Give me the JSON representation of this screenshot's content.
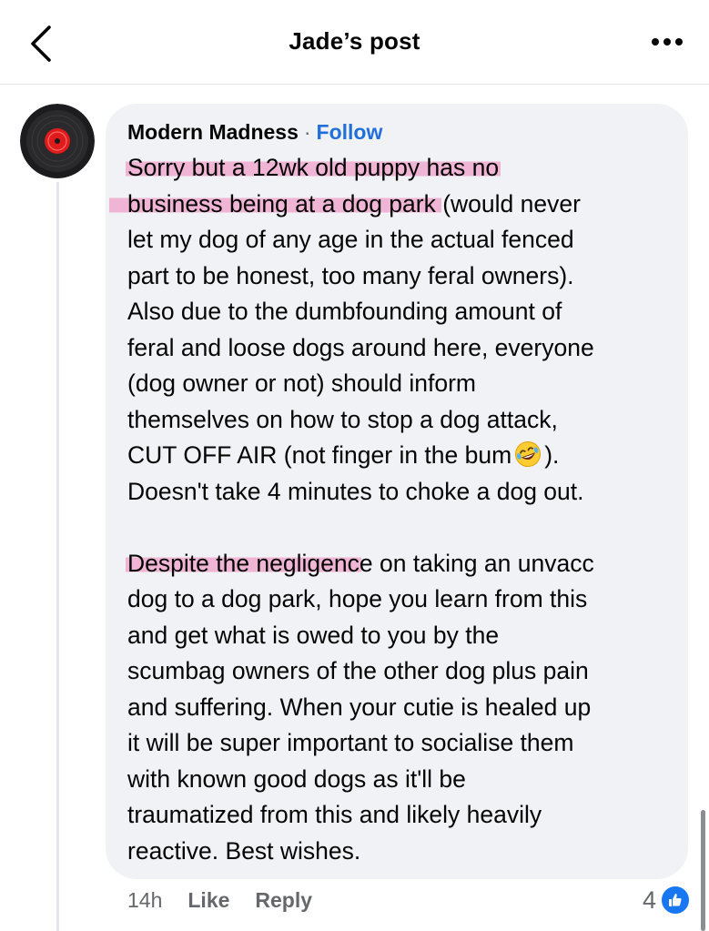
{
  "header": {
    "title": "Jade’s post",
    "back_icon": "chevron-left-icon",
    "more_icon": "more-horizontal-icon"
  },
  "comment": {
    "author": "Modern Madness",
    "separator": "·",
    "follow_label": "Follow",
    "lines_p1": {
      "l1": "Sorry but a 12wk old puppy has no",
      "l2a": "business being at a dog park",
      "l2b": " (would never",
      "l3": "let my dog of any age in the actual fenced",
      "l4": "part to be honest, too many feral owners).",
      "l5": "Also due to the dumbfounding amount of",
      "l6": "feral and loose dogs around here, everyone",
      "l7": "(dog owner or not) should inform",
      "l8": "themselves on how to stop a dog attack,",
      "l9a": "CUT OFF AIR (not finger in the bum",
      "l9b": ").",
      "l10": "Doesn't take 4 minutes to choke a dog out."
    },
    "lines_p2": {
      "l1a": "Despite the negligenc",
      "l1b": "e on taking an unvacc",
      "l2": "dog to a dog park, hope you learn from this",
      "l3": "and get what is owed to you by the",
      "l4": "scumbag owners of the other dog plus pain",
      "l5": "and suffering. When your cutie is healed up",
      "l6": "it will be super important to socialise them",
      "l7": "with known good dogs as it'll be",
      "l8": "traumatized from this and likely heavily",
      "l9": "reactive. Best wishes."
    },
    "emoji_name": "rolling-on-the-floor-laughing-emoji",
    "highlight_color": "#f082b9"
  },
  "actions": {
    "time": "14h",
    "like_label": "Like",
    "reply_label": "Reply",
    "reaction_count": "4",
    "reaction_icon": "like-thumb-icon"
  },
  "colors": {
    "bubble_bg": "#f0f2f5",
    "link_blue": "#216fdb",
    "muted_text": "#65676b",
    "like_blue": "#1877f2"
  }
}
